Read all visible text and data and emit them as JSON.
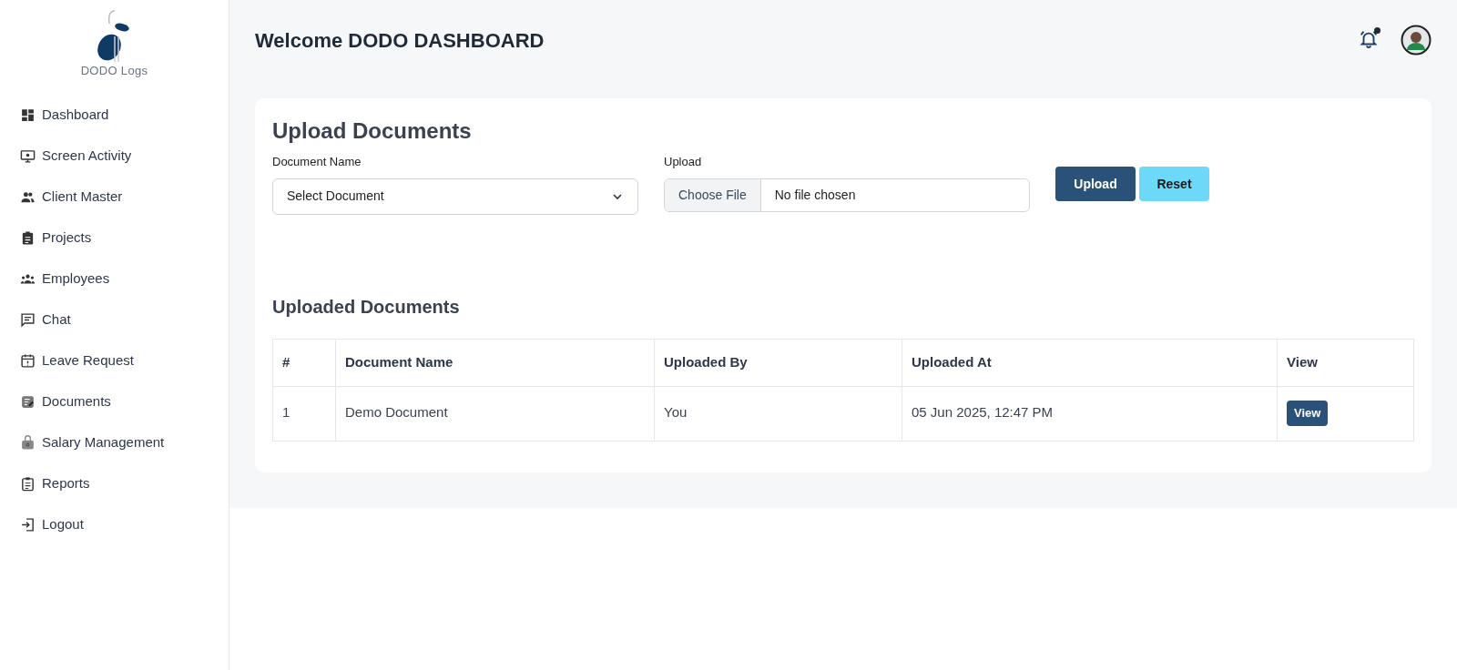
{
  "sidebar": {
    "logo_text": "DODO Logs",
    "items": [
      {
        "label": "Dashboard"
      },
      {
        "label": "Screen Activity"
      },
      {
        "label": "Client Master"
      },
      {
        "label": "Projects"
      },
      {
        "label": "Employees"
      },
      {
        "label": "Chat"
      },
      {
        "label": "Leave Request"
      },
      {
        "label": "Documents"
      },
      {
        "label": "Salary Management"
      },
      {
        "label": "Reports"
      },
      {
        "label": "Logout"
      }
    ]
  },
  "header": {
    "title": "Welcome DODO DASHBOARD",
    "has_notification": true
  },
  "upload_form": {
    "title": "Upload Documents",
    "document_label": "Document Name",
    "document_placeholder": "Select Document",
    "upload_label": "Upload",
    "choose_file": "Choose File",
    "file_status": "No file chosen",
    "buttons": [
      {
        "label": "Upload",
        "kind": "primary"
      },
      {
        "label": "Reset",
        "kind": "secondary"
      }
    ]
  },
  "uploaded": {
    "title": "Uploaded Documents",
    "columns": [
      "#",
      "Document Name",
      "Uploaded By",
      "Uploaded At",
      "View"
    ],
    "rows": [
      {
        "cells": [
          "1",
          "Demo Document",
          "You",
          "05 Jun 2025, 12:47 PM"
        ],
        "action": "View"
      }
    ]
  }
}
